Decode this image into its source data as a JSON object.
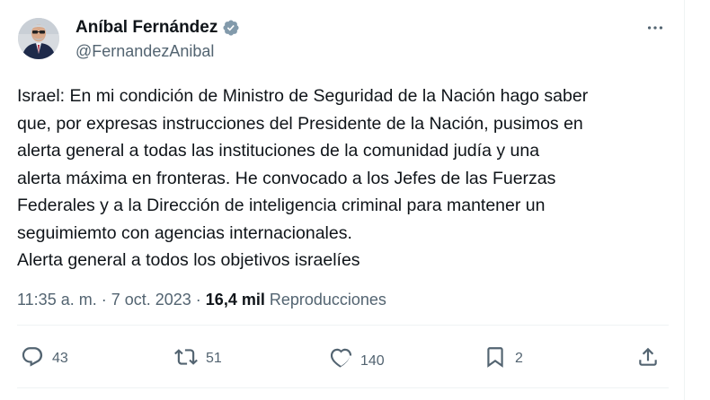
{
  "author": {
    "display_name": "Aníbal Fernández",
    "handle": "@FernandezAnibal",
    "verified": true
  },
  "tweet": {
    "lines": [
      "Israel: En mi condición de Ministro de Seguridad de la Nación hago saber",
      "que, por expresas instrucciones del Presidente de la Nación, pusimos en",
      "alerta general a todas las instituciones de la comunidad judía y una",
      "alerta máxima en fronteras. He convocado a los Jefes de las Fuerzas",
      "Federales y a la Dirección de inteligencia criminal para mantener un",
      "seguimiemto con agencias internacionales.",
      "Alerta general a todos los objetivos israelíes"
    ]
  },
  "meta": {
    "time": "11:35 a. m.",
    "dot1": " · ",
    "date": "7 oct. 2023",
    "dot2": " · ",
    "views_count": "16,4 mil",
    "views_label": " Reproducciones"
  },
  "actions": {
    "replies": "43",
    "reposts": "51",
    "likes": "140",
    "bookmarks": "2"
  },
  "icons": {
    "verified": "verified-badge-icon",
    "more": "more-dots-icon",
    "reply": "reply-icon",
    "repost": "repost-icon",
    "like": "heart-icon",
    "bookmark": "bookmark-icon",
    "share": "share-icon"
  },
  "colors": {
    "text": "#0f1419",
    "secondary": "#536471",
    "verified": "#829aab",
    "divider": "#eff3f4"
  }
}
